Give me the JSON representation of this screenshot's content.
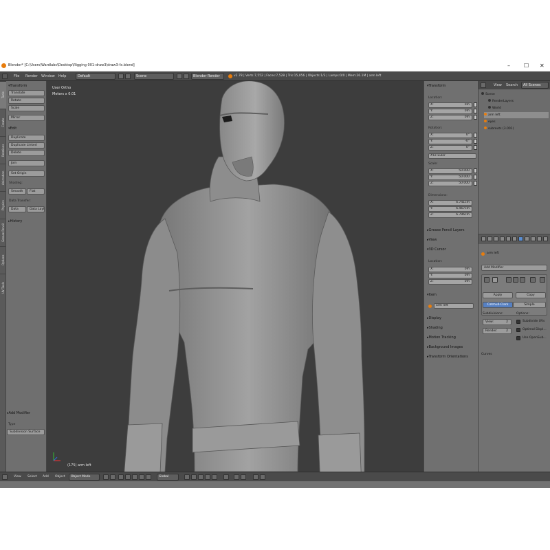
{
  "window": {
    "title": "Blender* [C:\\Users\\Wardlabs\\Desktop\\Rigging 001-draw3\\draw3-fx.blend]",
    "controls": [
      "–",
      "☐",
      "✕"
    ]
  },
  "info_header": {
    "menus": [
      "File",
      "Render",
      "Window",
      "Help"
    ],
    "layout": "Default",
    "scene": "Scene",
    "engine": "Blender Render",
    "stats": "v2.78 | Verts:7,552 | Faces:7,528 | Tris:15,056 | Objects:1/3 | Lamps:0/0 | Mem:26.1M | arm left"
  },
  "tool_shelf": {
    "tabs": [
      "Tools",
      "Create",
      "Relations",
      "Animation",
      "Physics",
      "Grease Pencil",
      "Options",
      "UV Tools"
    ],
    "transform_header": "Transform",
    "transform_buttons": [
      "Translate",
      "Rotate",
      "Scale",
      "Mirror"
    ],
    "edit_header": "Edit",
    "edit_buttons": [
      "Duplicate",
      "Duplicate Linked",
      "Delete",
      "Join"
    ],
    "set_origin": "Set Origin",
    "shading_label": "Shading:",
    "smooth": "Smooth",
    "flat": "Flat",
    "data_transfer_label": "Data Transfer:",
    "data": "Data",
    "data_layout": "Data Layt",
    "history_header": "History",
    "operator_header": "Add Modifier",
    "type_label": "Type",
    "type_value": "Subdivision Surface"
  },
  "viewport": {
    "view_label": "User Ortho",
    "units_label": "Meters x 0.01",
    "object_label": "(175) arm left"
  },
  "n_panel": {
    "transform_header": "Transform",
    "location_label": "Location:",
    "location": [
      {
        "axis": "X:",
        "value": "0m"
      },
      {
        "axis": "Y:",
        "value": "0m"
      },
      {
        "axis": "Z:",
        "value": "0m"
      }
    ],
    "rotation_label": "Rotation:",
    "rotation": [
      {
        "axis": "X:",
        "value": "0°"
      },
      {
        "axis": "Y:",
        "value": "-0°"
      },
      {
        "axis": "Z:",
        "value": "0°"
      }
    ],
    "rotation_mode": "XYZ Euler",
    "scale_label": "Scale:",
    "scale": [
      {
        "axis": "X:",
        "value": "50.000"
      },
      {
        "axis": "Y:",
        "value": "50.000"
      },
      {
        "axis": "Z:",
        "value": "50.000"
      }
    ],
    "dimensions_label": "Dimensions:",
    "dimensions": [
      {
        "axis": "X:",
        "value": "6.741cm"
      },
      {
        "axis": "Y:",
        "value": "6.467cm"
      },
      {
        "axis": "Z:",
        "value": "6.796cm"
      }
    ],
    "grease_pencil": "Grease Pencil Layers",
    "view": "View",
    "cursor_header": "3D Cursor",
    "cursor_location_label": "Location:",
    "cursor": [
      {
        "axis": "X:",
        "value": "0m"
      },
      {
        "axis": "Y:",
        "value": "0m"
      },
      {
        "axis": "Z:",
        "value": "0m"
      }
    ],
    "item_header": "Item",
    "item_name": "arm left",
    "closed_sections": [
      "Display",
      "Shading",
      "Motion Tracking",
      "Background Images",
      "Transform Orientations"
    ]
  },
  "outliner": {
    "menus": [
      "View",
      "Search"
    ],
    "filter": "All Scenes",
    "rows": [
      {
        "label": "Scene"
      },
      {
        "label": "RenderLayers"
      },
      {
        "label": "World"
      },
      {
        "label": "arm left"
      },
      {
        "label": "eyes"
      },
      {
        "label": "subrouts (3.001)"
      }
    ]
  },
  "properties": {
    "object_name": "arm left",
    "add_modifier": "Add Modifier",
    "apply": "Apply",
    "copy": "Copy",
    "catmull": "Catmull-Clark",
    "simple": "Simple",
    "subdivisions_label": "Subdivisions:",
    "view_field": "View:",
    "view_value": "2",
    "render_field": "Render:",
    "render_value": "2",
    "options_label": "Options:",
    "opt1": "Subdivide UVs",
    "opt2": "Optimal Displ...",
    "opt3": "Use OpenSub...",
    "curves": "Curves"
  },
  "bottom_header": {
    "menus": [
      "View",
      "Select",
      "Add",
      "Object"
    ],
    "mode": "Object Mode",
    "orientation": "Global"
  },
  "colors": {
    "accent": "#5680c2",
    "blender_orange": "#e87d0d",
    "model_gray": "#8e8e8e"
  }
}
